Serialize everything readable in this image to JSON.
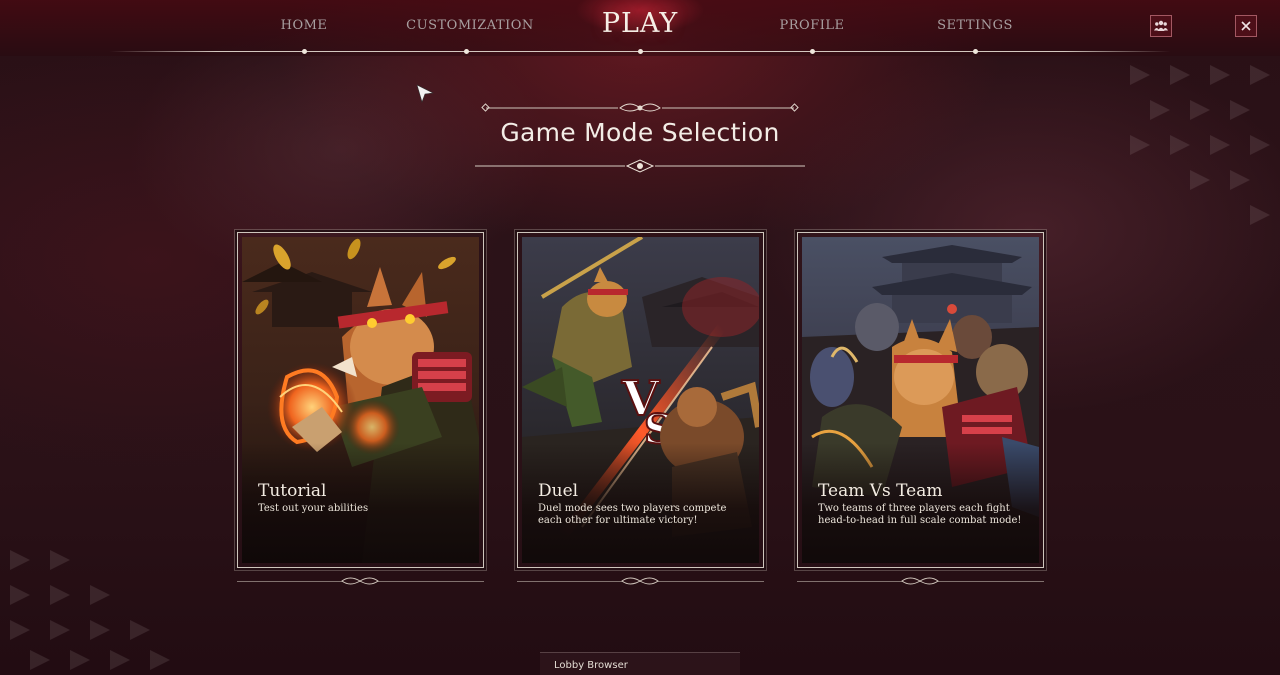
{
  "nav": {
    "items": [
      {
        "label": "HOME",
        "active": false
      },
      {
        "label": "CUSTOMIZATION",
        "active": false
      },
      {
        "label": "PLAY",
        "active": true
      },
      {
        "label": "PROFILE",
        "active": false
      },
      {
        "label": "SETTINGS",
        "active": false
      }
    ],
    "icons": [
      "friends-icon",
      "close-icon"
    ]
  },
  "page": {
    "title": "Game Mode Selection"
  },
  "modes": [
    {
      "title": "Tutorial",
      "description": "Test out your abilities",
      "art": "tutorial-art"
    },
    {
      "title": "Duel",
      "description": "Duel mode sees two players compete each other for ultimate victory!",
      "art": "duel-art",
      "badge": "VS"
    },
    {
      "title": "Team Vs Team",
      "description": "Two teams of three players each fight head-to-head in full scale combat mode!",
      "art": "team-art"
    }
  ],
  "footer": {
    "lobby_label": "Lobby Browser"
  },
  "colors": {
    "accent": "#8c1e28",
    "background": "#2a1016",
    "text": "#f3ede6"
  }
}
